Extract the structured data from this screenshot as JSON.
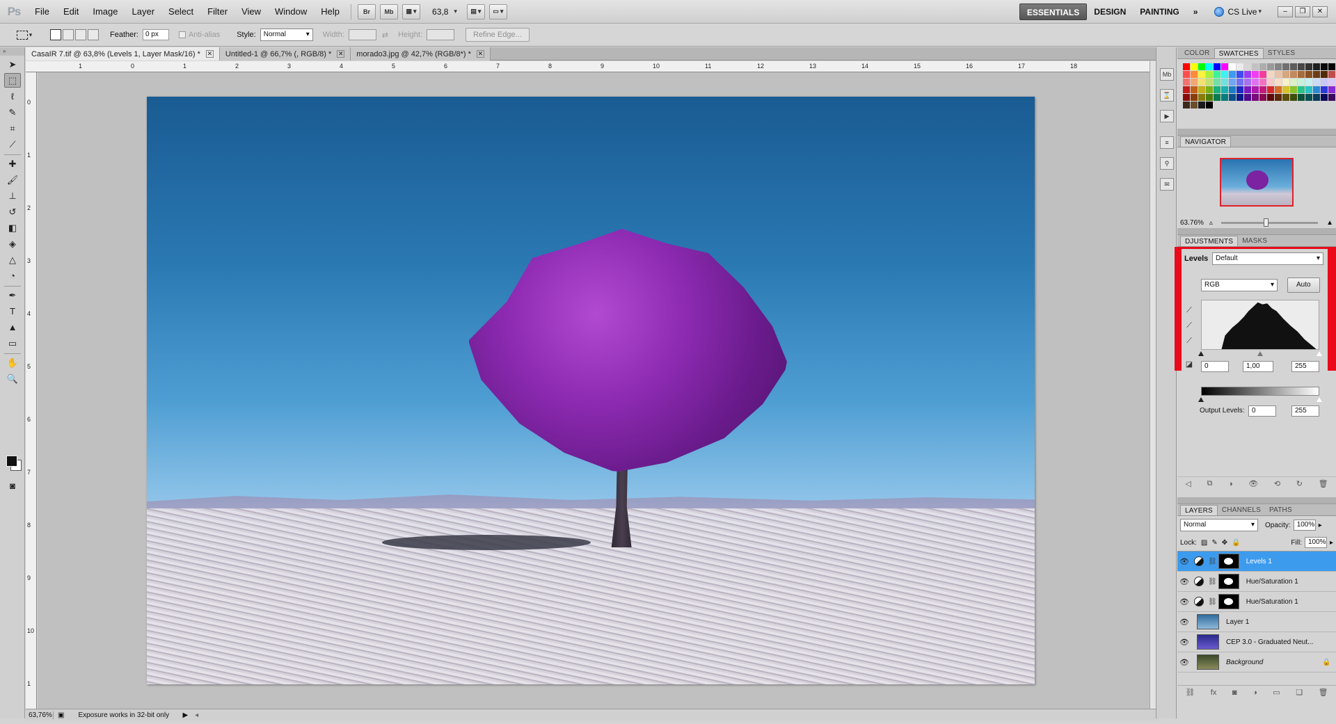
{
  "app": {
    "logo": "Ps"
  },
  "menu": [
    "File",
    "Edit",
    "Image",
    "Layer",
    "Select",
    "Filter",
    "View",
    "Window",
    "Help"
  ],
  "appbar": {
    "bridge_label": "Br",
    "minibridge_label": "Mb",
    "zoom_value": "63,8",
    "workspaces": [
      "ESSENTIALS",
      "DESIGN",
      "PAINTING"
    ],
    "more": "»",
    "cs_live": "CS Live"
  },
  "options": {
    "feather_label": "Feather:",
    "feather_value": "0 px",
    "antialias_label": "Anti-alias",
    "style_label": "Style:",
    "style_value": "Normal",
    "width_label": "Width:",
    "height_label": "Height:",
    "refine_edge": "Refine Edge..."
  },
  "tabs": [
    {
      "label": "CasaIR 7.tif @ 63,8% (Levels 1, Layer Mask/16) *",
      "active": true
    },
    {
      "label": "Untitled-1 @ 66,7% (, RGB/8) *",
      "active": false
    },
    {
      "label": "morado3.jpg @ 42,7% (RGB/8*) *",
      "active": false
    }
  ],
  "ruler_top": [
    "1",
    "0",
    "1",
    "2",
    "3",
    "4",
    "5",
    "6",
    "7",
    "8",
    "9",
    "10",
    "11",
    "12",
    "13",
    "14",
    "15",
    "16",
    "17",
    "18"
  ],
  "ruler_left": [
    "0",
    "1",
    "2",
    "3",
    "4",
    "5",
    "6",
    "7",
    "8",
    "9",
    "10",
    "1"
  ],
  "status": {
    "zoom": "63,76%",
    "message": "Exposure works in 32-bit only"
  },
  "panels": {
    "color_tabs": [
      "COLOR",
      "SWATCHES",
      "STYLES"
    ],
    "navigator_title": "NAVIGATOR",
    "navigator_zoom": "63.76%",
    "adjust_tabs": [
      "DJUSTMENTS",
      "MASKS"
    ],
    "levels_label": "Levels",
    "preset_value": "Default",
    "channel_value": "RGB",
    "auto_label": "Auto",
    "input_black": "0",
    "input_mid": "1,00",
    "input_white": "255",
    "output_label": "Output Levels:",
    "output_black": "0",
    "output_white": "255",
    "layers_tabs": [
      "LAYERS",
      "CHANNELS",
      "PATHS"
    ],
    "blend_mode": "Normal",
    "opacity_label": "Opacity:",
    "opacity_value": "100%",
    "lock_label": "Lock:",
    "fill_label": "Fill:",
    "fill_value": "100%"
  },
  "layers": [
    {
      "name": "Levels 1",
      "type": "adjustment",
      "active": true
    },
    {
      "name": "Hue/Saturation 1",
      "type": "adjustment",
      "active": false
    },
    {
      "name": "Hue/Saturation 1",
      "type": "adjustment",
      "active": false
    },
    {
      "name": "Layer 1",
      "type": "pixel",
      "active": false
    },
    {
      "name": "CEP 3.0 - Graduated Neut...",
      "type": "pixel",
      "active": false
    },
    {
      "name": "Background",
      "type": "background",
      "active": false
    }
  ],
  "colors": {
    "accent_selected": "#3d9bee",
    "highlight_frame": "#ea0a1a",
    "layer_thumb_colors": [
      "#2f6c9e",
      "#3a3aa5",
      "#50563a"
    ],
    "swatches": [
      "#ff0000",
      "#ffff00",
      "#00ff00",
      "#00ffff",
      "#0000ff",
      "#ff00ff",
      "#ffffff",
      "#ebebeb",
      "#d6d6d6",
      "#c2c2c2",
      "#adadad",
      "#999999",
      "#858585",
      "#707070",
      "#5c5c5c",
      "#474747",
      "#333333",
      "#1f1f1f",
      "#0a0a0a",
      "#000000",
      "#ff3030",
      "#ff4c4c",
      "#ff8a3c",
      "#fff23c",
      "#a6f23c",
      "#3cf29a",
      "#3cf2f2",
      "#3c9af2",
      "#3c4cf2",
      "#9a3cf2",
      "#f23cf2",
      "#f23c9a",
      "#f2d6c2",
      "#e6c2a6",
      "#d6a67c",
      "#c28a5c",
      "#a66c3c",
      "#8a5023",
      "#6c3c16",
      "#502a0a",
      "#c24c4c",
      "#e65c5c",
      "#f27272",
      "#f2a672",
      "#f2e072",
      "#c2e072",
      "#72e0a6",
      "#72e0e0",
      "#72a6f2",
      "#7272f2",
      "#a672f2",
      "#e072f2",
      "#f272c2",
      "#f7c8c8",
      "#f7dcc8",
      "#f7f0c8",
      "#dcf0c8",
      "#c8f0dc",
      "#c8f0f0",
      "#c8dcf7",
      "#c8c8f7",
      "#dcc8f7",
      "#f0c8f7",
      "#c21a1a",
      "#c2601a",
      "#c2b01a",
      "#7cb01a",
      "#1ab07c",
      "#1ab0b0",
      "#1a7cc2",
      "#1a2ac2",
      "#7c1ac2",
      "#b01ab0",
      "#c21a7c",
      "#d62a2a",
      "#d66c2a",
      "#d6c22a",
      "#8ac22a",
      "#2ac28a",
      "#2ac2c2",
      "#2a8ad6",
      "#2a3ad6",
      "#8a2ad6",
      "#c22ac2",
      "#8a0a0a",
      "#8a3c0a",
      "#8a7c0a",
      "#507c0a",
      "#0a7c50",
      "#0a7c7c",
      "#0a508a",
      "#0a1a8a",
      "#500a8a",
      "#7c0a7c",
      "#8a0a50",
      "#5c0a0a",
      "#5c2a0a",
      "#5c500a",
      "#3c500a",
      "#0a503c",
      "#0a5050",
      "#0a3c5c",
      "#0a0a5c",
      "#3c0a5c",
      "#500a50",
      "#3c2a1a",
      "#6c4c2a",
      "#1a1a1a",
      "#000000"
    ]
  }
}
